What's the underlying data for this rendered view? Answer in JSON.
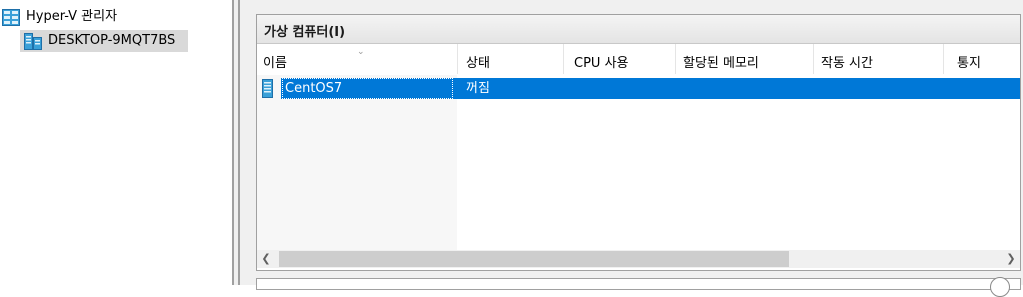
{
  "tree": {
    "root_label": "Hyper-V 관리자",
    "server_label": "DESKTOP-9MQT7BS"
  },
  "vm_panel": {
    "title": "가상 컴퓨터(I)",
    "columns": [
      "이름",
      "상태",
      "CPU 사용",
      "할당된 메모리",
      "작동 시간",
      "통지"
    ],
    "rows": [
      {
        "name": "CentOS7",
        "state": "꺼짐",
        "selected": true
      }
    ]
  },
  "colors": {
    "selection": "#0078d7",
    "panel_header": "#e8e8e8",
    "server_highlight": "#d9d9d9"
  },
  "icons": {
    "root": "hyper-v-manager-icon",
    "server": "server-icon",
    "vm": "virtual-machine-icon"
  }
}
